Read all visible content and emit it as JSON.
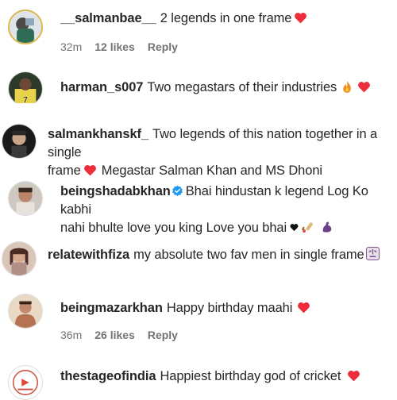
{
  "comments": [
    {
      "username": "__salmanbae__",
      "text": "2 legends in one frame",
      "time": "32m",
      "likes": "12 likes",
      "reply": "Reply",
      "avatar": "avatar-salmanbae"
    },
    {
      "username": "harman_s007",
      "text": "Two megastars of their industries",
      "avatar": "avatar-harman"
    },
    {
      "username": "salmankhanskf_",
      "text_line1": "Two legends of this nation together in a single",
      "text_line2_a": "frame",
      "text_line2_b": "Megastar Salman Khan and MS Dhoni",
      "avatar": "avatar-salmankhanskf"
    },
    {
      "username": "beingshadabkhan",
      "text_line1": "Bhai hindustan k legend Log Ko kabhi",
      "text_line2": "nahi bhulte love you king Love you bhai",
      "avatar": "avatar-beingshadabkhan"
    },
    {
      "username": "relatewithfiza",
      "text": "my absolute two fav men in single frame",
      "avatar": "avatar-relatewithfiza"
    },
    {
      "username": "beingmazarkhan",
      "text": "Happy birthday maahi",
      "time": "36m",
      "likes": "26 likes",
      "reply": "Reply",
      "avatar": "avatar-beingmazarkhan"
    },
    {
      "username": "thestageofindia",
      "text": "Happiest birthday god of cricket",
      "avatar": "avatar-thestageofindia"
    }
  ],
  "colors": {
    "heart": "#ed2d3b",
    "verified": "#1d9bf0",
    "meta": "#737373",
    "text": "#262626"
  }
}
